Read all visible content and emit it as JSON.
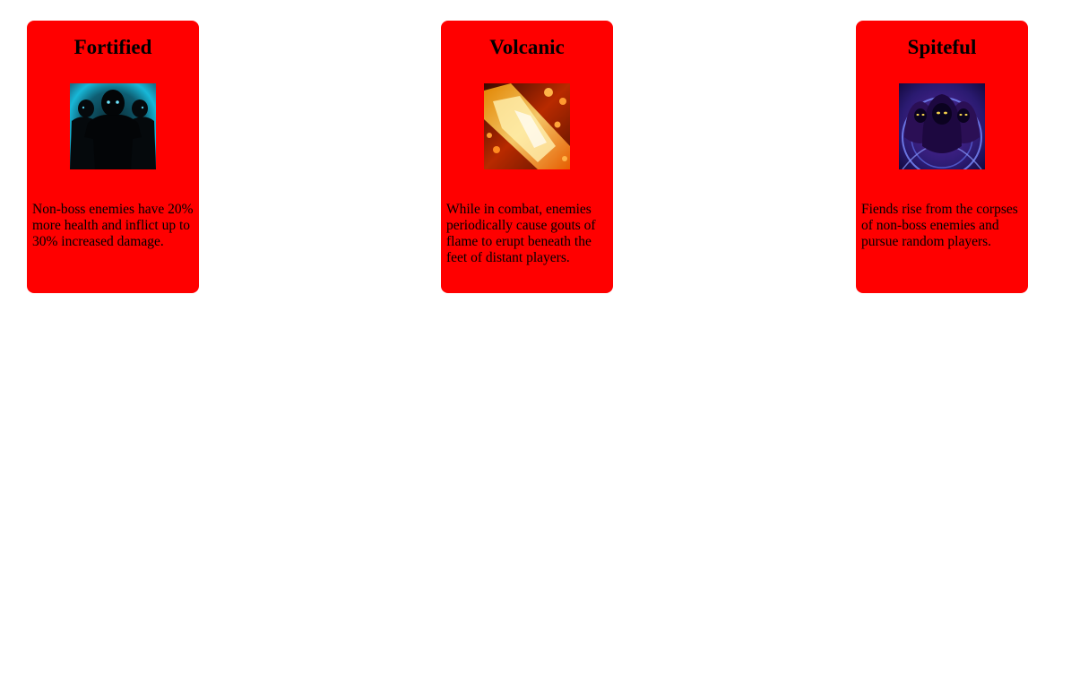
{
  "affixes": [
    {
      "title": "Fortified",
      "icon": "fortified-silhouette-icon",
      "description": "Non-boss enemies have 20% more health and inflict up to 30% increased damage."
    },
    {
      "title": "Volcanic",
      "icon": "volcanic-flame-icon",
      "description": "While in combat, enemies periodically cause gouts of flame to erupt beneath the feet of distant players."
    },
    {
      "title": "Spiteful",
      "icon": "spiteful-fiends-icon",
      "description": "Fiends rise from the corpses of non-boss enemies and pursue random players."
    }
  ],
  "colors": {
    "card_background": "#ff0000",
    "page_background": "#ffffff",
    "text": "#000000"
  }
}
